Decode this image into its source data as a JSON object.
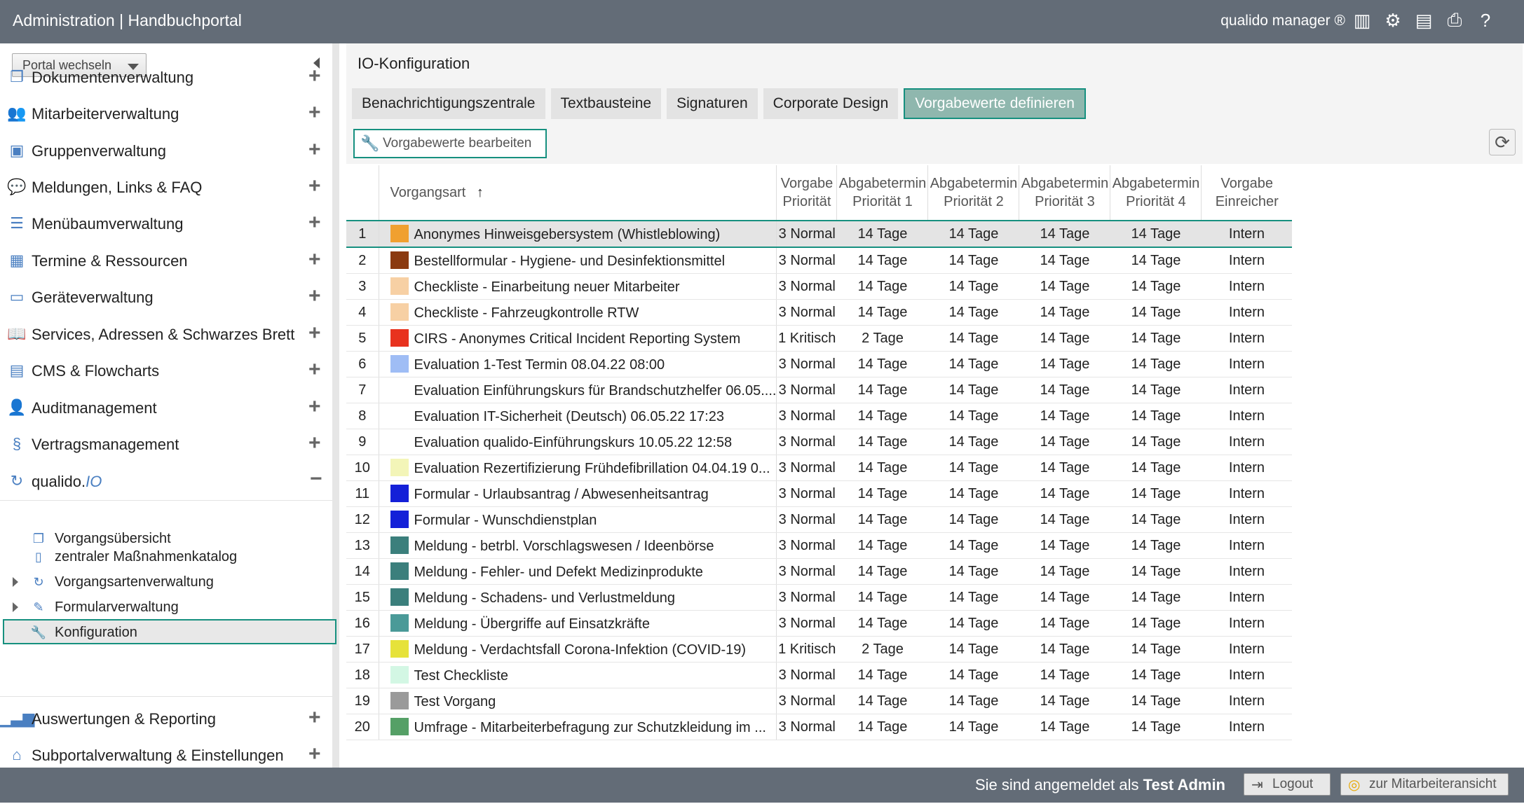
{
  "header": {
    "title": "Administration | Handbuchportal",
    "brand": "qualido manager ®",
    "icons": [
      "barcode-icon",
      "settings-gears-icon",
      "xlsx-export-icon",
      "print-icon",
      "help-icon"
    ]
  },
  "sidebar": {
    "portal_select": "Portal wechseln",
    "items": [
      {
        "label": "Dokumentenverwaltung",
        "icon": "documents-icon"
      },
      {
        "label": "Mitarbeiterverwaltung",
        "icon": "users-icon"
      },
      {
        "label": "Gruppenverwaltung",
        "icon": "groups-icon"
      },
      {
        "label": "Meldungen, Links & FAQ",
        "icon": "chat-icon"
      },
      {
        "label": "Menübaumverwaltung",
        "icon": "list-icon"
      },
      {
        "label": "Termine & Ressourcen",
        "icon": "calendar-icon"
      },
      {
        "label": "Geräteverwaltung",
        "icon": "device-icon"
      },
      {
        "label": "Services, Adressen & Schwarzes Brett",
        "icon": "book-icon"
      },
      {
        "label": "CMS & Flowcharts",
        "icon": "cms-icon"
      },
      {
        "label": "Auditmanagement",
        "icon": "auditor-icon"
      },
      {
        "label": "Vertragsmanagement",
        "icon": "paragraph-icon"
      }
    ],
    "qualido": {
      "label_main": "qualido.",
      "label_io": "IO"
    },
    "sub_items": [
      {
        "label": "Vorgangsübersicht",
        "icon": "document-icon"
      },
      {
        "label": "zentraler Maßnahmenkatalog",
        "icon": "catalog-icon"
      },
      {
        "label": "Vorgangsartenverwaltung",
        "icon": "cycle-icon"
      },
      {
        "label": "Formularverwaltung",
        "icon": "form-icon"
      },
      {
        "label": "Konfiguration",
        "icon": "wrench-icon"
      }
    ],
    "bottom_items": [
      {
        "label": "Auswertungen & Reporting",
        "icon": "bar-chart-icon"
      },
      {
        "label": "Subportalverwaltung & Einstellungen",
        "icon": "home-icon"
      }
    ]
  },
  "main": {
    "title": "IO-Konfiguration",
    "tabs": [
      "Benachrichtigungszentrale",
      "Textbausteine",
      "Signaturen",
      "Corporate Design",
      "Vorgabewerte definieren"
    ],
    "edit_button": "Vorgabewerte bearbeiten",
    "columns": {
      "vorgangsart": "Vorgangsart",
      "sort_arrow": "↑",
      "prio": [
        "Vorgabe",
        "Priorität"
      ],
      "p1": [
        "Abgabetermin",
        "Priorität 1"
      ],
      "p2": [
        "Abgabetermin",
        "Priorität 2"
      ],
      "p3": [
        "Abgabetermin",
        "Priorität 3"
      ],
      "p4": [
        "Abgabetermin",
        "Priorität 4"
      ],
      "einr": [
        "Vorgabe",
        "Einreicher"
      ]
    },
    "rows": [
      {
        "n": "1",
        "color": "#f0a030",
        "name": "Anonymes Hinweisgebersystem (Whistleblowing)",
        "prio": "3 Normal",
        "p1": "14 Tage",
        "p2": "14 Tage",
        "p3": "14 Tage",
        "p4": "14 Tage",
        "einr": "Intern"
      },
      {
        "n": "2",
        "color": "#8b3a10",
        "name": "Bestellformular - Hygiene- und Desinfektionsmittel",
        "prio": "3 Normal",
        "p1": "14 Tage",
        "p2": "14 Tage",
        "p3": "14 Tage",
        "p4": "14 Tage",
        "einr": "Intern"
      },
      {
        "n": "3",
        "color": "#f7d0a4",
        "name": "Checkliste - Einarbeitung neuer Mitarbeiter",
        "prio": "3 Normal",
        "p1": "14 Tage",
        "p2": "14 Tage",
        "p3": "14 Tage",
        "p4": "14 Tage",
        "einr": "Intern"
      },
      {
        "n": "4",
        "color": "#f7d0a4",
        "name": "Checkliste - Fahrzeugkontrolle RTW",
        "prio": "3 Normal",
        "p1": "14 Tage",
        "p2": "14 Tage",
        "p3": "14 Tage",
        "p4": "14 Tage",
        "einr": "Intern"
      },
      {
        "n": "5",
        "color": "#e8321e",
        "name": "CIRS - Anonymes Critical Incident Reporting System",
        "prio": "1 Kritisch",
        "p1": "2 Tage",
        "p2": "14 Tage",
        "p3": "14 Tage",
        "p4": "14 Tage",
        "einr": "Intern"
      },
      {
        "n": "6",
        "color": "#9fbdf5",
        "name": "Evaluation 1-Test Termin 08.04.22 08:00",
        "prio": "3 Normal",
        "p1": "14 Tage",
        "p2": "14 Tage",
        "p3": "14 Tage",
        "p4": "14 Tage",
        "einr": "Intern"
      },
      {
        "n": "7",
        "color": "",
        "name": "Evaluation Einführungskurs für Brandschutzhelfer 06.05....",
        "prio": "3 Normal",
        "p1": "14 Tage",
        "p2": "14 Tage",
        "p3": "14 Tage",
        "p4": "14 Tage",
        "einr": "Intern"
      },
      {
        "n": "8",
        "color": "",
        "name": "Evaluation IT-Sicherheit (Deutsch) 06.05.22 17:23",
        "prio": "3 Normal",
        "p1": "14 Tage",
        "p2": "14 Tage",
        "p3": "14 Tage",
        "p4": "14 Tage",
        "einr": "Intern"
      },
      {
        "n": "9",
        "color": "",
        "name": "Evaluation qualido-Einführungskurs 10.05.22 12:58",
        "prio": "3 Normal",
        "p1": "14 Tage",
        "p2": "14 Tage",
        "p3": "14 Tage",
        "p4": "14 Tage",
        "einr": "Intern"
      },
      {
        "n": "10",
        "color": "#f3f5b8",
        "name": "Evaluation Rezertifizierung Frühdefibrillation 04.04.19 0...",
        "prio": "3 Normal",
        "p1": "14 Tage",
        "p2": "14 Tage",
        "p3": "14 Tage",
        "p4": "14 Tage",
        "einr": "Intern"
      },
      {
        "n": "11",
        "color": "#1420d8",
        "name": "Formular - Urlaubsantrag / Abwesenheitsantrag",
        "prio": "3 Normal",
        "p1": "14 Tage",
        "p2": "14 Tage",
        "p3": "14 Tage",
        "p4": "14 Tage",
        "einr": "Intern"
      },
      {
        "n": "12",
        "color": "#1420d8",
        "name": "Formular - Wunschdienstplan",
        "prio": "3 Normal",
        "p1": "14 Tage",
        "p2": "14 Tage",
        "p3": "14 Tage",
        "p4": "14 Tage",
        "einr": "Intern"
      },
      {
        "n": "13",
        "color": "#3b7f7c",
        "name": "Meldung - betrbl. Vorschlagswesen / Ideenbörse",
        "prio": "3 Normal",
        "p1": "14 Tage",
        "p2": "14 Tage",
        "p3": "14 Tage",
        "p4": "14 Tage",
        "einr": "Intern"
      },
      {
        "n": "14",
        "color": "#3b7f7c",
        "name": "Meldung - Fehler- und Defekt Medizinprodukte",
        "prio": "3 Normal",
        "p1": "14 Tage",
        "p2": "14 Tage",
        "p3": "14 Tage",
        "p4": "14 Tage",
        "einr": "Intern"
      },
      {
        "n": "15",
        "color": "#3b7f7c",
        "name": "Meldung - Schadens- und Verlustmeldung",
        "prio": "3 Normal",
        "p1": "14 Tage",
        "p2": "14 Tage",
        "p3": "14 Tage",
        "p4": "14 Tage",
        "einr": "Intern"
      },
      {
        "n": "16",
        "color": "#4a9a98",
        "name": "Meldung - Übergriffe auf Einsatzkräfte",
        "prio": "3 Normal",
        "p1": "14 Tage",
        "p2": "14 Tage",
        "p3": "14 Tage",
        "p4": "14 Tage",
        "einr": "Intern"
      },
      {
        "n": "17",
        "color": "#e6e23a",
        "name": "Meldung - Verdachtsfall Corona-Infektion (COVID-19)",
        "prio": "1 Kritisch",
        "p1": "2 Tage",
        "p2": "14 Tage",
        "p3": "14 Tage",
        "p4": "14 Tage",
        "einr": "Intern"
      },
      {
        "n": "18",
        "color": "#d3f7e4",
        "name": "Test Checkliste",
        "prio": "3 Normal",
        "p1": "14 Tage",
        "p2": "14 Tage",
        "p3": "14 Tage",
        "p4": "14 Tage",
        "einr": "Intern"
      },
      {
        "n": "19",
        "color": "#9a9a9a",
        "name": "Test Vorgang",
        "prio": "3 Normal",
        "p1": "14 Tage",
        "p2": "14 Tage",
        "p3": "14 Tage",
        "p4": "14 Tage",
        "einr": "Intern"
      },
      {
        "n": "20",
        "color": "#55a066",
        "name": "Umfrage - Mitarbeiterbefragung zur Schutzkleidung im ...",
        "prio": "3 Normal",
        "p1": "14 Tage",
        "p2": "14 Tage",
        "p3": "14 Tage",
        "p4": "14 Tage",
        "einr": "Intern"
      }
    ]
  },
  "statusbar": {
    "logged_in_prefix": "Sie sind angemeldet als",
    "user": "Test Admin",
    "logout": "Logout",
    "employee_view": "zur Mitarbeiteransicht"
  },
  "colors": {
    "accent": "#16907f",
    "header_bg": "#636c77",
    "active_tab_bg": "#8fb7ae",
    "icon_blue": "#4a7fc1"
  }
}
